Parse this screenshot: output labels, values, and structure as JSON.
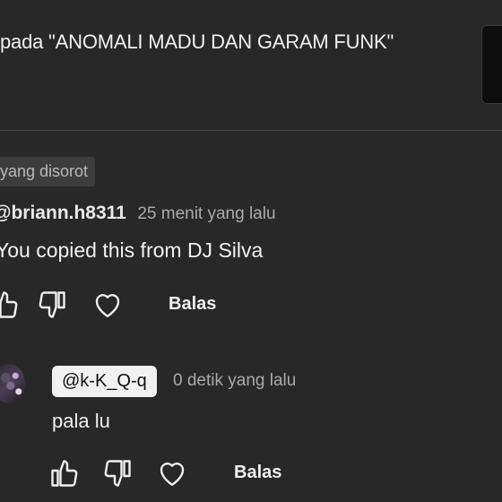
{
  "header": {
    "title": "pada \"ANOMALI MADU DAN GARAM FUNK\""
  },
  "comment": {
    "badge": "yang disorot",
    "author": "@briann.h8311",
    "timestamp": "25 menit yang lalu",
    "text": "You copied this from DJ Silva",
    "reply_label": "Balas"
  },
  "reply": {
    "author": "@k-K_Q-q",
    "timestamp": "0 detik yang lalu",
    "text": "pala lu",
    "reply_label": "Balas"
  },
  "icons": {
    "like": "thumbs-up-icon",
    "dislike": "thumbs-down-icon",
    "heart": "heart-icon"
  },
  "colors": {
    "background": "#282828",
    "text_primary": "#f1f1f1",
    "text_secondary": "#aaaaaa",
    "badge_bg": "#3d3d3d",
    "author_chip_bg": "#f1f1f1"
  }
}
